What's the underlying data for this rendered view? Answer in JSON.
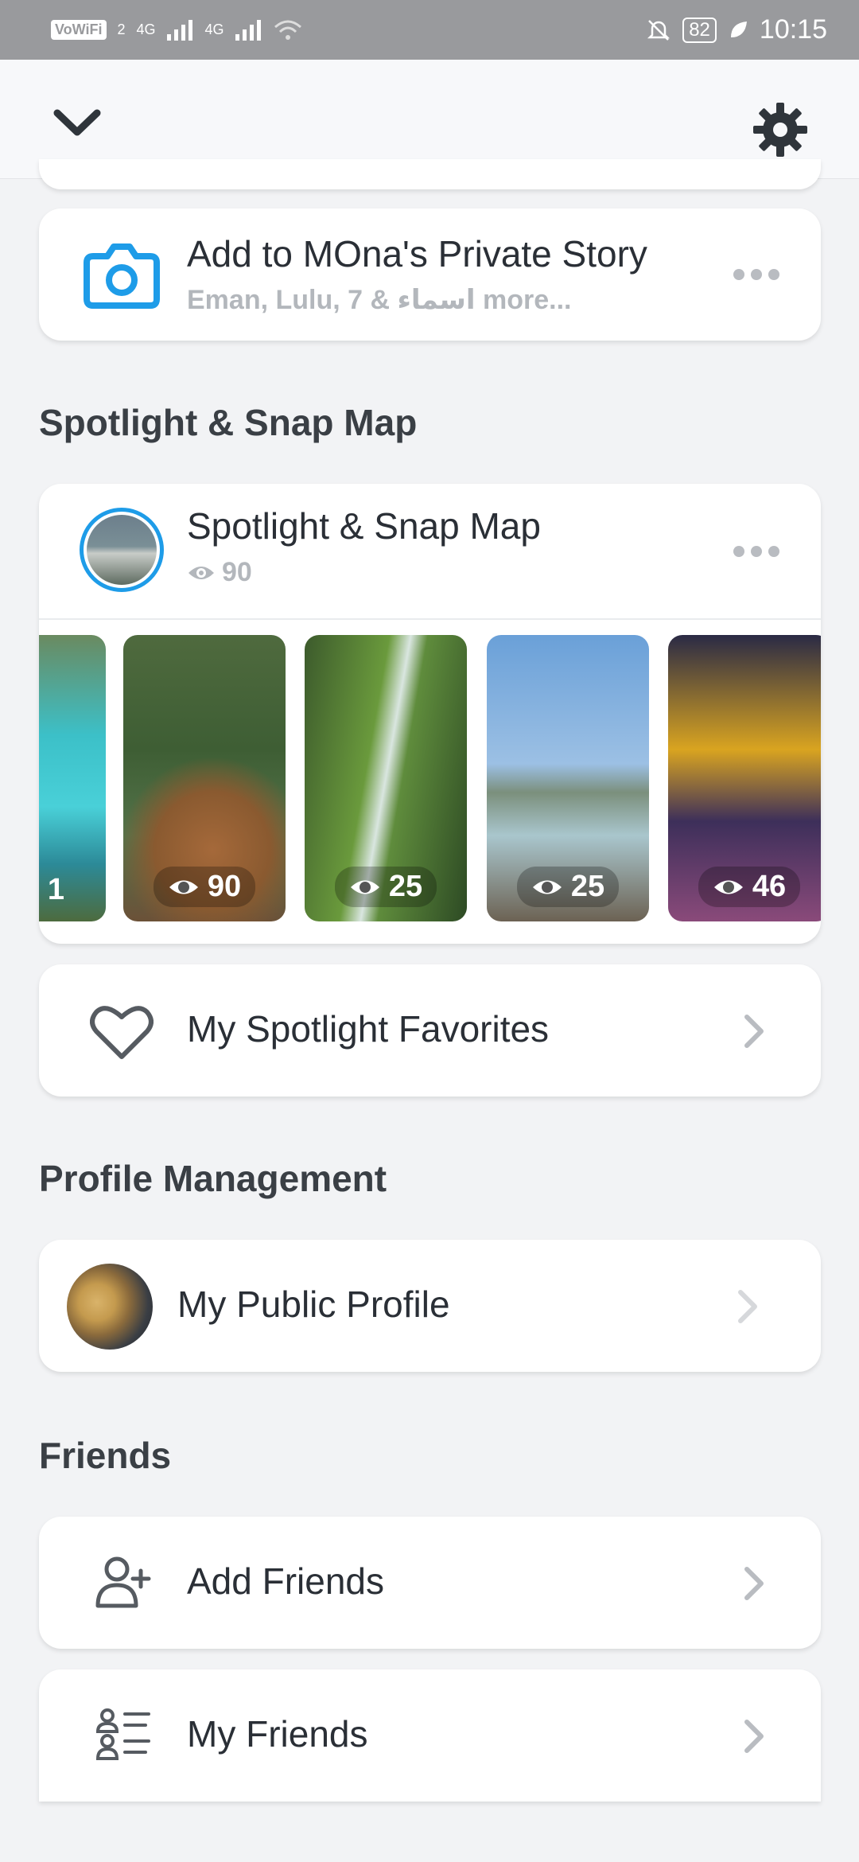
{
  "status_bar": {
    "vowifi": "VoWiFi",
    "sim2": "2",
    "net1": "4G",
    "net2": "4G",
    "battery": "82",
    "time": "10:15"
  },
  "private_story": {
    "title": "Add to MOna's Private Story",
    "subtitle": "Eman, Lulu, 7 & اسماء more..."
  },
  "spotlight_section": {
    "heading": "Spotlight & Snap Map",
    "card_title": "Spotlight & Snap Map",
    "views": "90",
    "thumbnails": [
      {
        "views": "1"
      },
      {
        "views": "90"
      },
      {
        "views": "25"
      },
      {
        "views": "25"
      },
      {
        "views": "46"
      }
    ],
    "favorites_label": "My Spotlight Favorites"
  },
  "profile_section": {
    "heading": "Profile Management",
    "public_profile_label": "My Public Profile"
  },
  "friends_section": {
    "heading": "Friends",
    "add_friends_label": "Add Friends",
    "my_friends_label": "My Friends"
  },
  "colors": {
    "accent_blue": "#1e9ce8",
    "text": "#2a2f36",
    "muted": "#b3b7bc"
  }
}
